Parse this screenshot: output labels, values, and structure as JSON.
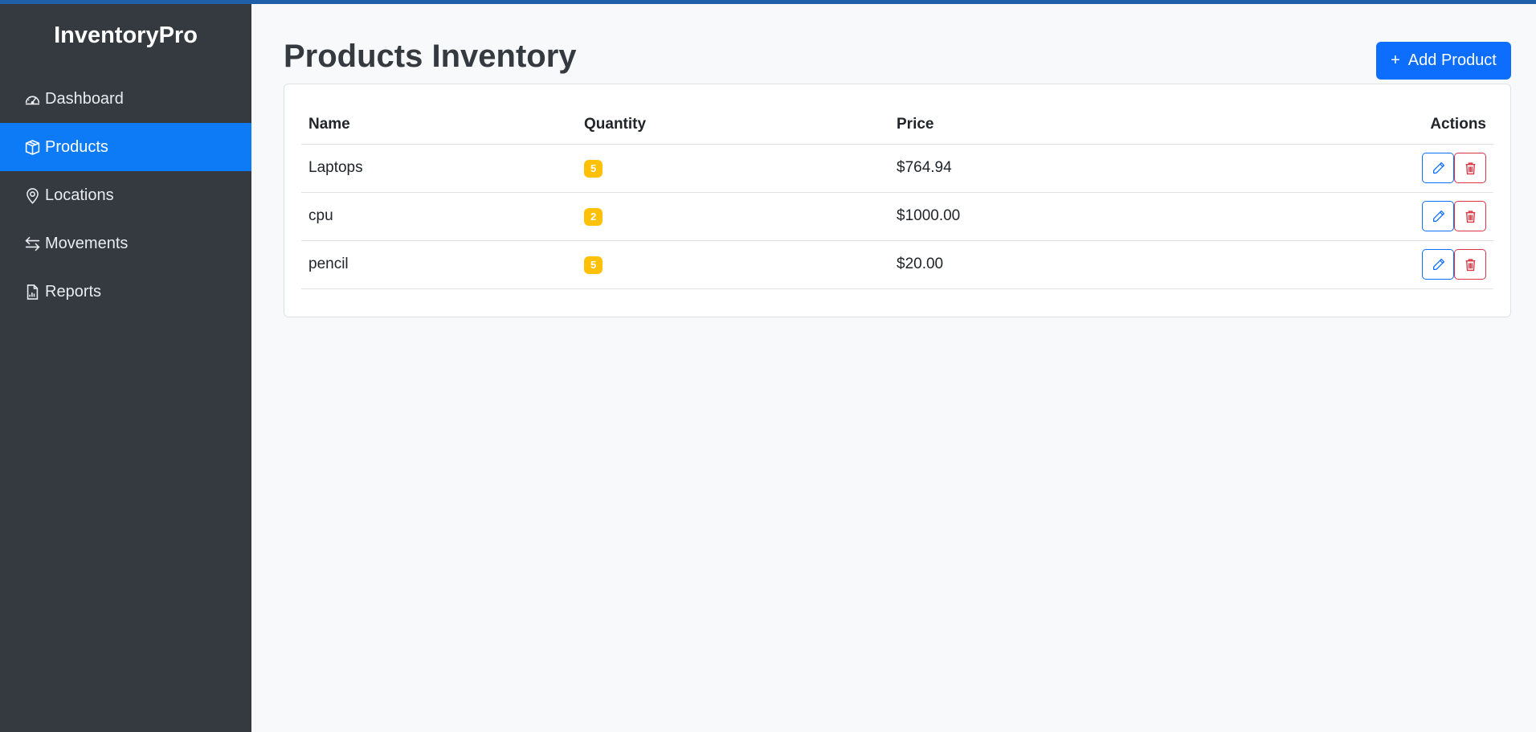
{
  "app": {
    "brand": "InventoryPro"
  },
  "sidebar": {
    "items": [
      {
        "label": "Dashboard",
        "icon": "speedometer-icon",
        "active": false
      },
      {
        "label": "Products",
        "icon": "box-icon",
        "active": true
      },
      {
        "label": "Locations",
        "icon": "map-pin-icon",
        "active": false
      },
      {
        "label": "Movements",
        "icon": "arrows-exchange-icon",
        "active": false
      },
      {
        "label": "Reports",
        "icon": "report-chart-icon",
        "active": false
      }
    ]
  },
  "page": {
    "title": "Products Inventory",
    "add_button": "Add Product",
    "add_icon": "+"
  },
  "table": {
    "headers": {
      "name": "Name",
      "quantity": "Quantity",
      "price": "Price",
      "actions": "Actions"
    },
    "rows": [
      {
        "name": "Laptops",
        "quantity": "5",
        "price": "$764.94"
      },
      {
        "name": "cpu",
        "quantity": "2",
        "price": "$1000.00"
      },
      {
        "name": "pencil",
        "quantity": "5",
        "price": "$20.00"
      }
    ]
  },
  "colors": {
    "sidebar_bg": "#343a40",
    "active_nav": "#0d7bf5",
    "primary": "#0d6efd",
    "danger": "#dc3545",
    "warning_badge": "#ffc107",
    "page_bg": "#f8f9fa"
  }
}
